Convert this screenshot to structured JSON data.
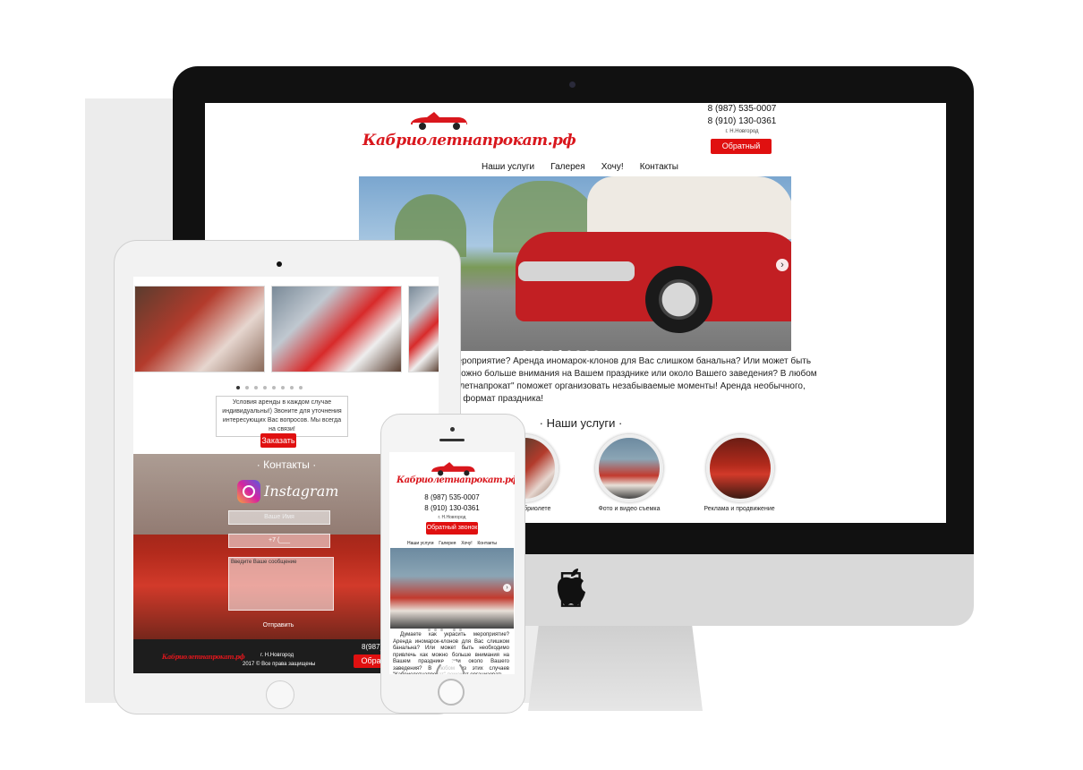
{
  "brand": {
    "logo_text": "Кабриолетнапрокат.рф"
  },
  "contacts": {
    "phone1": "8 (987) 535-0007",
    "phone2": "8 (910) 130-0361",
    "city": "г. Н.Новгород",
    "callback_label": "Обратный звонок"
  },
  "nav": [
    "Наши услуги",
    "Галерея",
    "Хочу!",
    "Контакты"
  ],
  "desktop": {
    "intro_lines": [
      "ть мероприятие? Аренда иномарок-клонов для Вас слишком банальна? Или может быть",
      "как можно больше внимания на Вашем празднике или около Вашего заведения? В любом",
      "бриолетнапрокат\" поможет организовать незабываемые моменты! Аренда необычного,",
      "овый формат праздника!"
    ],
    "services_title": "· Наши услуги ·",
    "services": [
      {
        "label": "кабриолете"
      },
      {
        "label": "Фото и видео съемка"
      },
      {
        "label": "Реклама и продвижение"
      }
    ]
  },
  "tablet": {
    "note": "Условия аренды в каждом случае индивидуальны!) Звоните для уточнения интересующих Вас вопросов. Мы всегда на связи!",
    "order_label": "Заказать",
    "contacts_title": "· Контакты ·",
    "instagram_label": "Instagram",
    "name_placeholder": "Ваше Имя",
    "phone_placeholder": "+7 (___",
    "message_placeholder": "Введите Ваше сообщение",
    "send_label": "Отправить",
    "footer_city": "г. Н.Новгород",
    "footer_copyright": "2017 © Все права защищены",
    "footer_phone": "8(987)53",
    "footer_callback": "Обратн"
  },
  "phone": {
    "intro": "Думаете как украсить мероприятие? Аренда иномарок-клонов для Вас слишком банальна? Или может быть необходимо привлечь как можно больше внимания на Вашем празднике или около Вашего заведения? В любом из этих случаев \"Кабриолетнапрокат\" поможет организовать"
  },
  "icons": {
    "apple": "apple-logo-icon",
    "next": "chevron-right-icon",
    "instagram": "instagram-icon"
  },
  "colors": {
    "accent": "#e01010",
    "logo": "#d9171d",
    "device_dark": "#111111",
    "device_silver": "#d9d9d9"
  }
}
